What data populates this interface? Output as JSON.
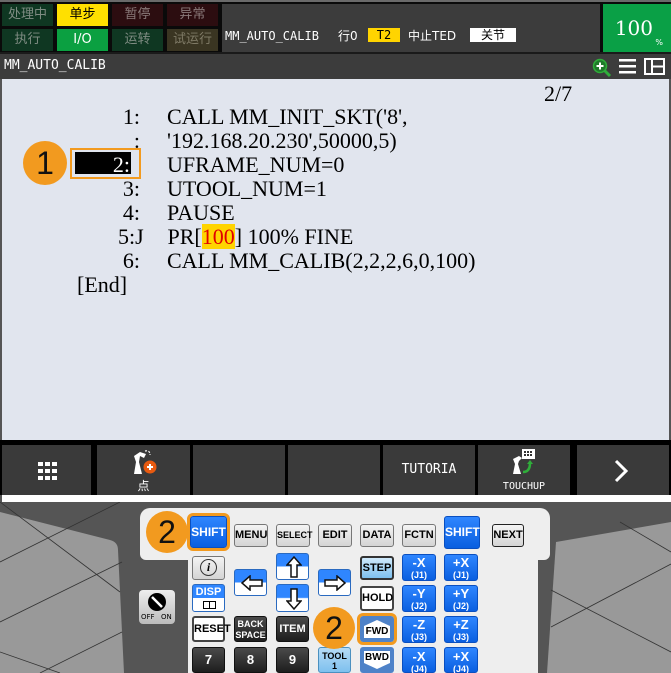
{
  "status_bar": {
    "row1": [
      {
        "label": "处理中",
        "state": "inactive"
      },
      {
        "label": "单步",
        "state": "active-yellow"
      },
      {
        "label": "暂停",
        "state": "inactive"
      },
      {
        "label": "异常",
        "state": "inactive"
      }
    ],
    "row2": [
      {
        "label": "执行",
        "state": "inactive"
      },
      {
        "label": "I/O",
        "state": "active-green"
      },
      {
        "label": "运转",
        "state": "inactive"
      },
      {
        "label": "试运行",
        "state": "inactive"
      }
    ],
    "program_name": "MM_AUTO_CALIB",
    "line_label": "行0",
    "mode_badge": "T2",
    "abort_status": "中止TED",
    "coord_badge": "关节",
    "override_value": "100",
    "override_unit": "%"
  },
  "title_bar": {
    "title": "MM_AUTO_CALIB",
    "icons": [
      "zoom-in-icon",
      "menu-icon",
      "split-view-icon"
    ]
  },
  "editor": {
    "page_indicator": "2/7",
    "lines": [
      {
        "num": "1:",
        "text": "CALL MM_INIT_SKT('8',"
      },
      {
        "num": ":",
        "text": "'192.168.20.230',50000,5)"
      },
      {
        "num": "2:",
        "text": "UFRAME_NUM=0",
        "selected": true
      },
      {
        "num": "3:",
        "text": "UTOOL_NUM=1"
      },
      {
        "num": "4:",
        "text": "PAUSE"
      },
      {
        "num": "5:J",
        "text_pre": " PR[",
        "text_hl": "100",
        "text_post": "] 100% FINE"
      },
      {
        "num": "6:",
        "text": "CALL MM_CALIB(2,2,2,6,0,100)"
      }
    ],
    "end_marker": "[End]"
  },
  "callouts": {
    "one": "1",
    "two": "2"
  },
  "function_keys": [
    {
      "label": "",
      "icon": "grid-icon"
    },
    {
      "label": "点",
      "icon": "robot-add-point-icon"
    },
    {
      "label": "",
      "icon": ""
    },
    {
      "label": "",
      "icon": ""
    },
    {
      "label": "TUTORIA",
      "icon": ""
    },
    {
      "label": "TOUCHUP",
      "icon": "robot-touchup-icon"
    },
    {
      "label": "",
      "icon": "chevron-right-icon"
    }
  ],
  "keypad": {
    "top_row": [
      "SHIFT",
      "MENU",
      "SELECT",
      "EDIT",
      "DATA",
      "FCTN",
      "SHIFT",
      "NEXT"
    ],
    "info": "i",
    "disp": "DISP",
    "reset": "RESET",
    "backspace": [
      "BACK",
      "SPACE"
    ],
    "item": "ITEM",
    "step": "STEP",
    "hold": "HOLD",
    "fwd": "FWD",
    "bwd": "BWD",
    "tool": [
      "TOOL",
      "1"
    ],
    "digits": [
      "7",
      "8",
      "9"
    ],
    "jog": [
      {
        "minus": "-X",
        "minus_sub": "(J1)",
        "plus": "+X",
        "plus_sub": "(J1)"
      },
      {
        "minus": "-Y",
        "minus_sub": "(J2)",
        "plus": "+Y",
        "plus_sub": "(J2)"
      },
      {
        "minus": "-Z",
        "minus_sub": "(J3)",
        "plus": "+Z",
        "plus_sub": "(J3)"
      },
      {
        "minus": "-X",
        "minus_sub": "(J4)",
        "plus": "+X",
        "plus_sub": "(J4)"
      }
    ],
    "switch_off": "OFF",
    "switch_on": "ON"
  }
}
